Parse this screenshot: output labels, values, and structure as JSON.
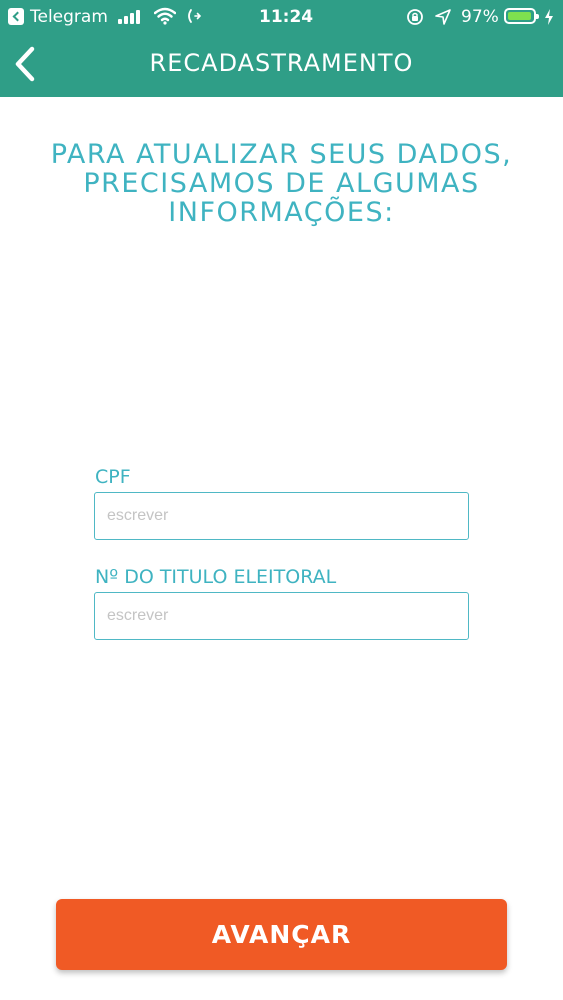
{
  "status_bar": {
    "back_app": "Telegram",
    "time": "11:24",
    "battery_percent": "97%",
    "battery_level": 0.97,
    "battery_color": "#7ee04f"
  },
  "nav": {
    "title": "RECADASTRAMENTO",
    "back_icon": "chevron-left-icon"
  },
  "heading": {
    "lines": [
      "PARA ATUALIZAR SEUS DADOS,",
      "PRECISAMOS DE ALGUMAS",
      "INFORMAÇÕES:"
    ]
  },
  "form": {
    "cpf": {
      "label": "CPF",
      "placeholder": "escrever",
      "value": ""
    },
    "titulo": {
      "label": "Nº DO TITULO ELEITORAL",
      "placeholder": "escrever",
      "value": ""
    }
  },
  "button": {
    "label": "AVANÇAR"
  },
  "colors": {
    "header": "#2f9e87",
    "accent_text": "#3fb3c1",
    "button": "#f05a25"
  }
}
